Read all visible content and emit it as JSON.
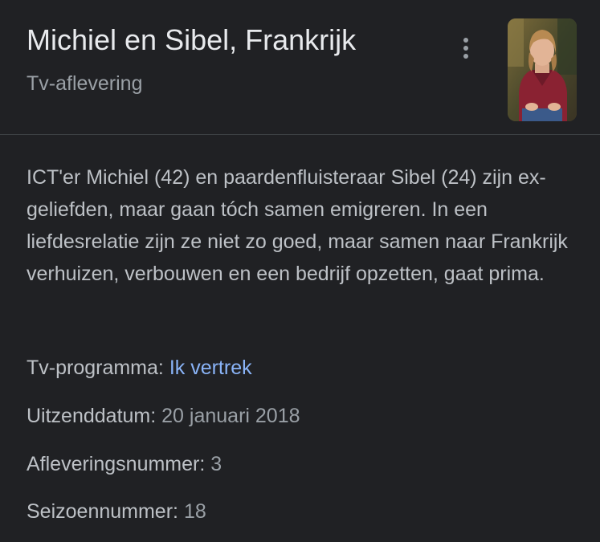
{
  "header": {
    "title": "Michiel en Sibel, Frankrijk",
    "subtitle": "Tv-aflevering"
  },
  "description": "ICT'er Michiel (42) en paardenfluisteraar Sibel (24) zijn ex-geliefden, maar gaan tóch samen emigreren. In een liefdesrelatie zijn ze niet zo goed, maar samen naar Frankrijk verhuizen, verbouwen en een bedrijf opzetten, gaat prima.",
  "facts": {
    "program": {
      "label": "Tv-programma: ",
      "value": "Ik vertrek"
    },
    "airdate": {
      "label": "Uitzenddatum: ",
      "value": "20 januari 2018"
    },
    "episode": {
      "label": "Afleveringsnummer: ",
      "value": "3"
    },
    "season": {
      "label": "Seizoennummer: ",
      "value": "18"
    }
  },
  "icons": {
    "more": "more-vert-icon",
    "thumbnail": "person-photo"
  },
  "colors": {
    "background": "#202124",
    "title": "#e8eaed",
    "secondary": "#9aa0a6",
    "body": "#bdc1c6",
    "link": "#8ab4f8",
    "divider": "#3c4043"
  }
}
